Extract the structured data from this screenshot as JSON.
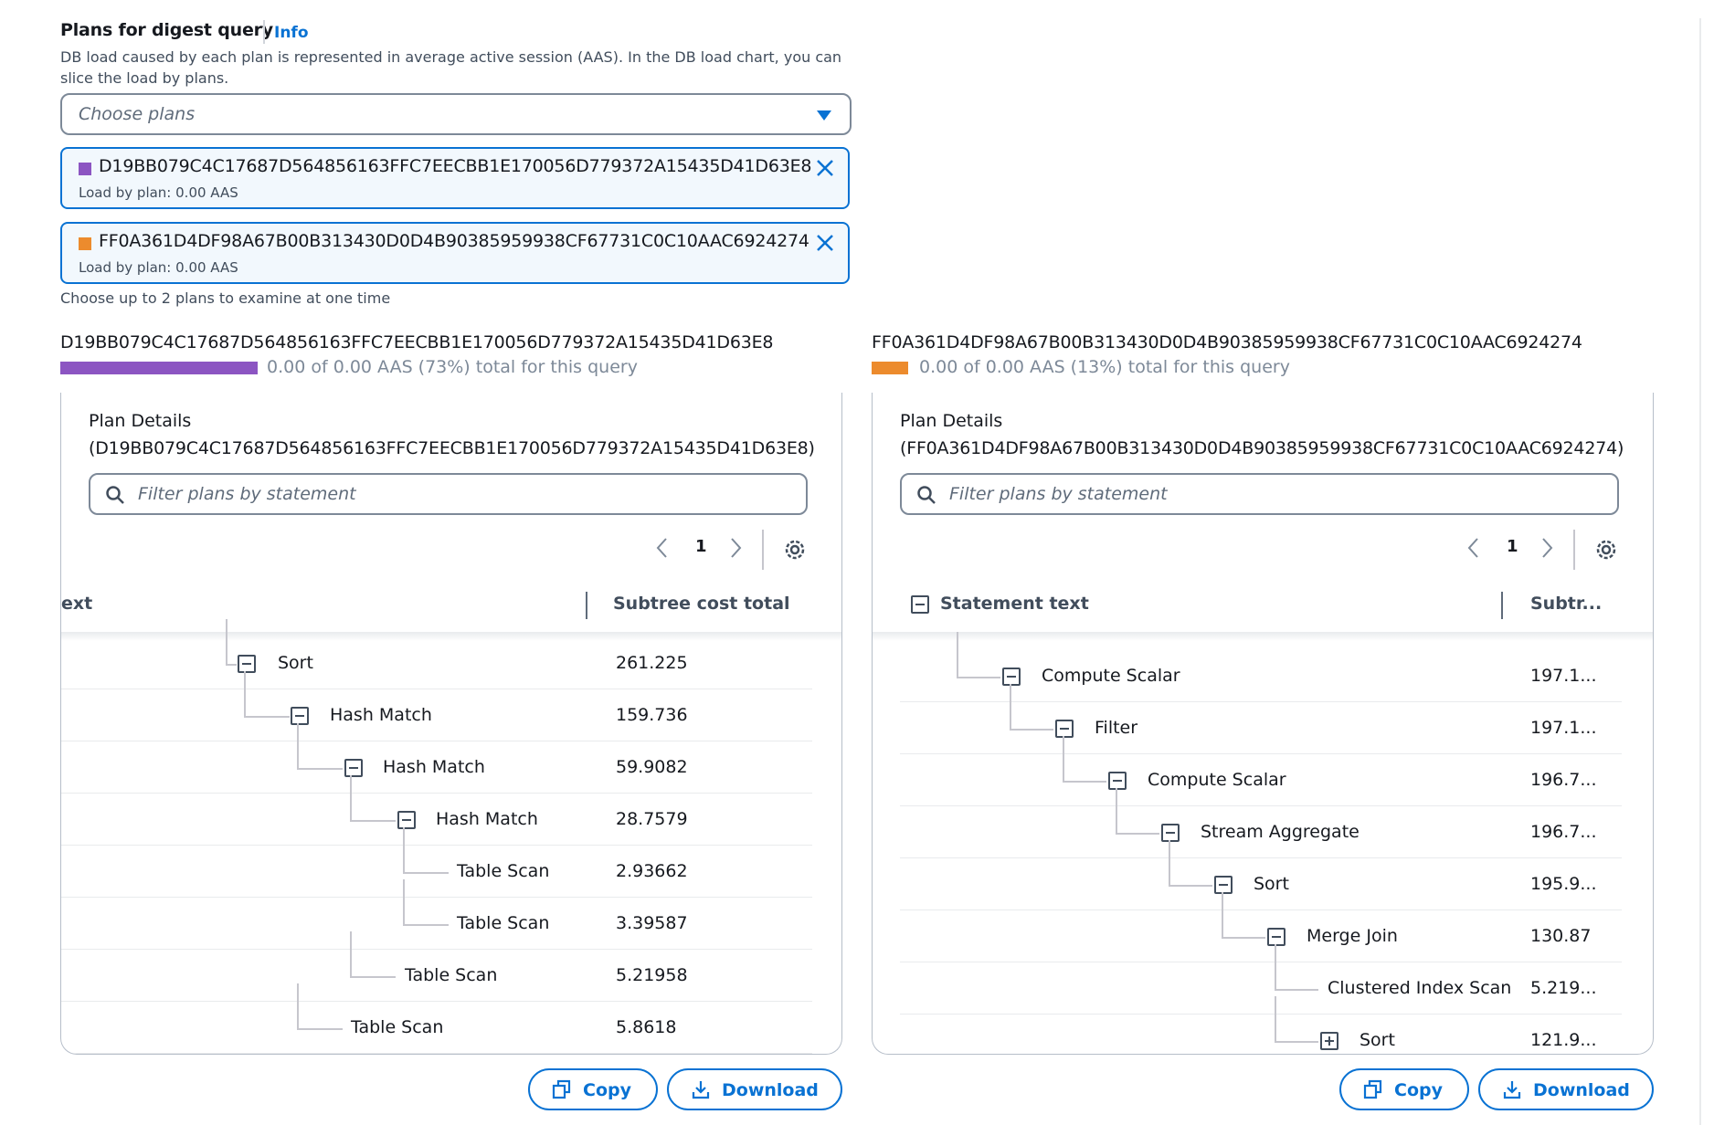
{
  "header": {
    "title": "Plans for digest query",
    "info_link": "Info",
    "description": "DB load caused by each plan is represented in average active session (AAS). In the DB load chart, you can slice the load by plans."
  },
  "plan_select": {
    "placeholder": "Choose plans",
    "tokens": [
      {
        "id": "D19BB079C4C17687D564856163FFC7EECBB1E170056D779372A15435D41D63E8",
        "load": "Load by plan: 0.00 AAS",
        "color": "#8c55c2"
      },
      {
        "id": "FF0A361D4DF98A67B00B313430D0D4B90385959938CF67731C0C10AAC6924274",
        "load": "Load by plan: 0.00 AAS",
        "color": "#ec8b2d"
      }
    ],
    "hint": "Choose up to 2 plans to examine at one time"
  },
  "plans": [
    {
      "id": "D19BB079C4C17687D564856163FFC7EECBB1E170056D779372A15435D41D63E8",
      "summary": "0.00 of 0.00 AAS (73%) total for this query",
      "share": 0.73,
      "color": "#8c55c2",
      "details_title": "Plan Details",
      "details_id": "(D19BB079C4C17687D564856163FFC7EECBB1E170056D779372A15435D41D63E8)",
      "filter_placeholder": "Filter plans by statement",
      "page": "1",
      "columns": {
        "statement": "ext",
        "cost": "Subtree cost total"
      },
      "rows": [
        {
          "name": "Sort",
          "cost": "261.225",
          "toggle": "minus"
        },
        {
          "name": "Hash Match",
          "cost": "159.736",
          "toggle": "minus"
        },
        {
          "name": "Hash Match",
          "cost": "59.9082",
          "toggle": "minus"
        },
        {
          "name": "Hash Match",
          "cost": "28.7579",
          "toggle": "minus"
        },
        {
          "name": "Table Scan",
          "cost": "2.93662",
          "toggle": "none"
        },
        {
          "name": "Table Scan",
          "cost": "3.39587",
          "toggle": "none"
        },
        {
          "name": "Table Scan",
          "cost": "5.21958",
          "toggle": "none"
        },
        {
          "name": "Table Scan",
          "cost": "5.8618",
          "toggle": "none"
        }
      ],
      "copy_label": "Copy",
      "download_label": "Download"
    },
    {
      "id": "FF0A361D4DF98A67B00B313430D0D4B90385959938CF67731C0C10AAC6924274",
      "summary": "0.00 of 0.00 AAS (13%) total for this query",
      "share": 0.13,
      "color": "#ec8b2d",
      "details_title": "Plan Details",
      "details_id": "(FF0A361D4DF98A67B00B313430D0D4B90385959938CF67731C0C10AAC6924274)",
      "filter_placeholder": "Filter plans by statement",
      "page": "1",
      "columns": {
        "statement": "Statement text",
        "cost": "Subtr..."
      },
      "rows": [
        {
          "name": "Compute Scalar",
          "cost": "197.1...",
          "toggle": "minus"
        },
        {
          "name": "Filter",
          "cost": "197.1...",
          "toggle": "minus"
        },
        {
          "name": "Compute Scalar",
          "cost": "196.7...",
          "toggle": "minus"
        },
        {
          "name": "Stream Aggregate",
          "cost": "196.7...",
          "toggle": "minus"
        },
        {
          "name": "Sort",
          "cost": "195.9...",
          "toggle": "minus"
        },
        {
          "name": "Merge Join",
          "cost": "130.87",
          "toggle": "minus"
        },
        {
          "name": "Clustered Index Scan",
          "cost": "5.219...",
          "toggle": "none"
        },
        {
          "name": "Sort",
          "cost": "121.9...",
          "toggle": "plus"
        }
      ],
      "copy_label": "Copy",
      "download_label": "Download"
    }
  ]
}
